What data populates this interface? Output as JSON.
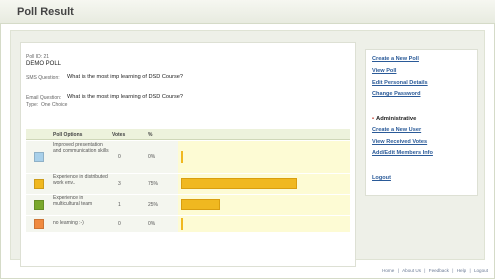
{
  "page": {
    "title": "Poll Result"
  },
  "poll": {
    "id_label": "Poll ID: 21",
    "name": "DEMO POLL",
    "sms_question_label": "SMS Question:",
    "sms_question": "What is the most imp learning of DSD Course?",
    "email_question_label": "Email Question:",
    "email_question": "What is the most imp learning of DSD Course?",
    "type_label": "Type:",
    "type_value": "One Choice"
  },
  "results": {
    "headers": {
      "options": "Poll Options",
      "votes": "Votes",
      "percent": "%"
    },
    "rows": [
      {
        "option": "Improved presentation and communication skills",
        "votes": "0",
        "percent": "0%",
        "percent_value": 0,
        "color": "#a8d0ea"
      },
      {
        "option": "Experience in distributed work env..",
        "votes": "3",
        "percent": "75%",
        "percent_value": 75,
        "color": "#f0b820"
      },
      {
        "option": "Experience in multicultural team",
        "votes": "1",
        "percent": "25%",
        "percent_value": 25,
        "color": "#7aa82c"
      },
      {
        "option": "no learning :-)",
        "votes": "0",
        "percent": "0%",
        "percent_value": 0,
        "color": "#f08a40"
      }
    ]
  },
  "sidebar": {
    "links": [
      {
        "label": "Create a New Poll"
      },
      {
        "label": "View Poll"
      },
      {
        "label": "Edit Personal Details"
      },
      {
        "label": "Change Password"
      }
    ],
    "admin_heading": "Administrative",
    "admin_links": [
      {
        "label": "Create a New User"
      },
      {
        "label": "View Received Votes"
      },
      {
        "label": "Add/Edit Members Info"
      }
    ],
    "logout": "Logout"
  },
  "footer": {
    "links": [
      "Home",
      "About Us",
      "Feedback",
      "Help",
      "Logout"
    ],
    "separator": "|"
  }
}
